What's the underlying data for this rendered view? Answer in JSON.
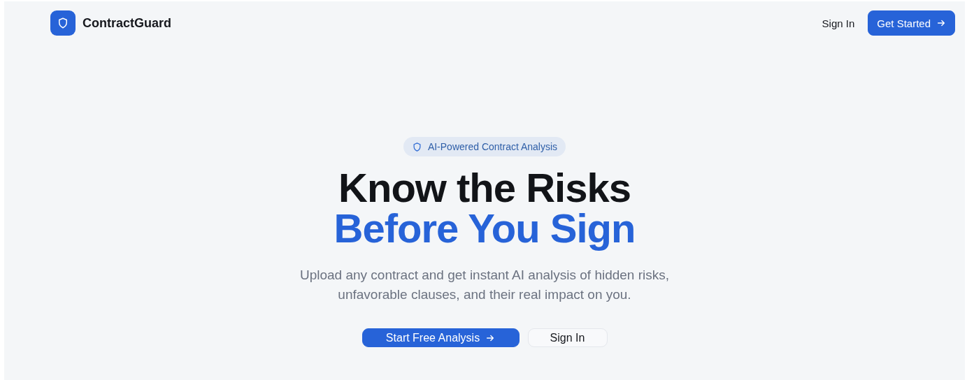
{
  "header": {
    "brand": "ContractGuard",
    "nav": [
      {
        "label": "Sign In",
        "kind": "link"
      },
      {
        "label": "Get Started",
        "kind": "primary"
      }
    ]
  },
  "hero": {
    "badge": "AI-Powered Contract Analysis",
    "title_line_1": "Know the Risks",
    "title_line_2": "Before You Sign",
    "subtitle": "Upload any contract and get instant AI analysis of hidden risks, unfavorable clauses, and their real impact on you.",
    "buttons": [
      {
        "label": "Start Free Analysis",
        "kind": "primary"
      },
      {
        "label": "Sign In",
        "kind": "outline"
      }
    ]
  }
}
